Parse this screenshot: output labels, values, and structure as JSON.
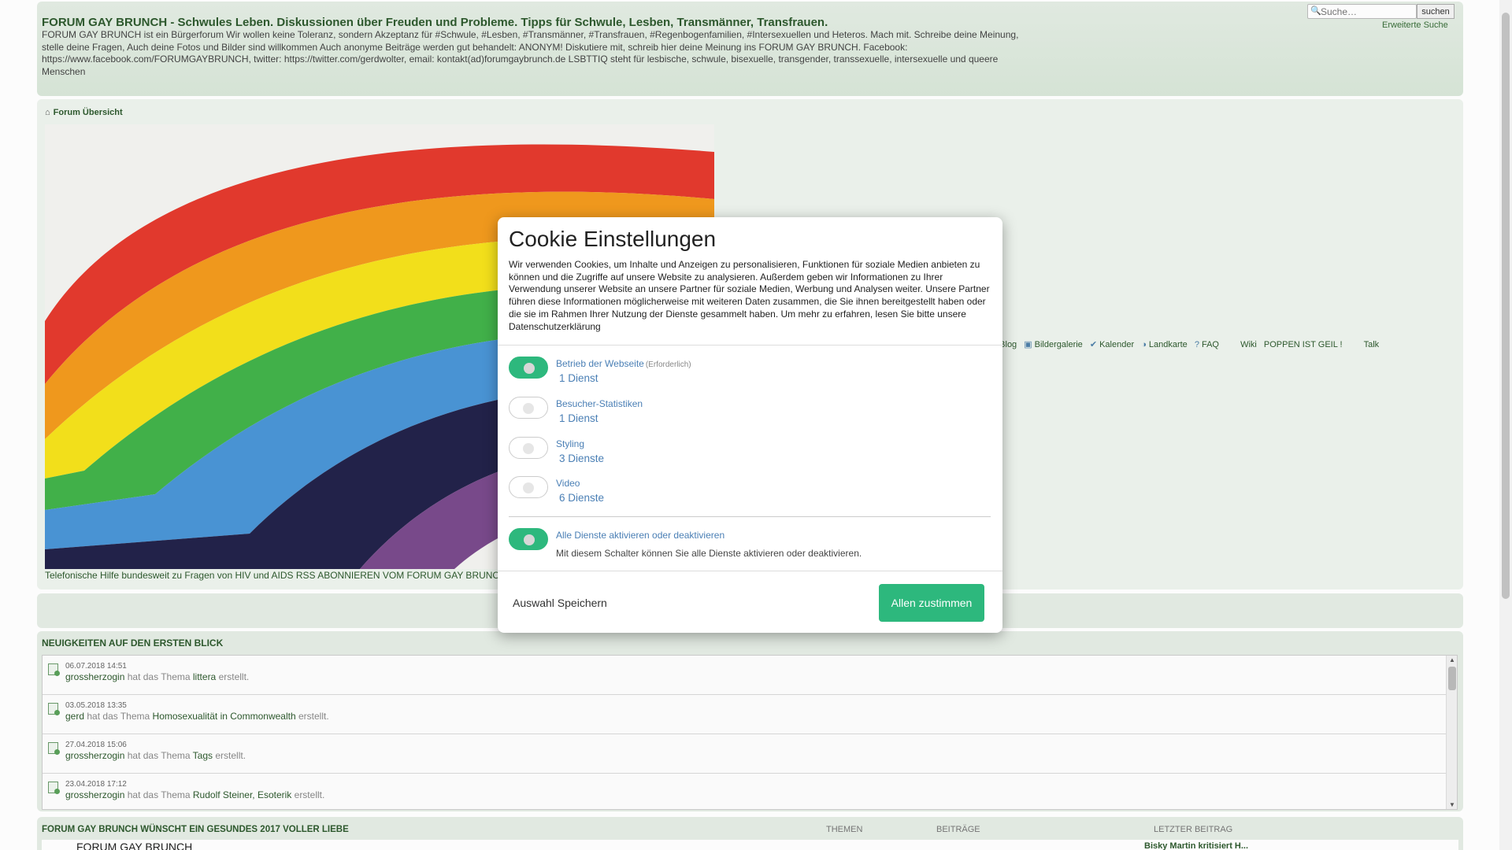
{
  "header": {
    "title": "FORUM GAY BRUNCH - Schwules Leben. Diskussionen über Freuden und Probleme. Tipps für Schwule, Lesben, Transmänner, Transfrauen.",
    "description": "FORUM GAY BRUNCH ist ein Bürgerforum Wir wollen keine Toleranz, sondern Akzeptanz für #Schwule, #Lesben, #Transmänner, #Transfrauen, #Regenbogenfamilien, #Intersexuellen und Heteros. Mach mit. Schreibe deine Meinung, stelle deine Fragen, Auch deine Fotos und Bilder sind willkommen Auch anonyme Beiträge werden gut behandelt: ANONYM! Diskutiere mit, schreib hier deine Meinung ins FORUM GAY BRUNCH. Facebook: https://www.facebook.com/FORUMGAYBRUNCH, twitter: https://twitter.com/gerdwolter, email: kontakt(ad)forumgaybrunch.de LSBTTIQ steht für lesbische, schwule, bisexuelle, transgender, transsexuelle, intersexuelle und queere Menschen",
    "search_placeholder": "Suche…",
    "search_button": "suchen",
    "advanced_search": "Erweiterte Suche"
  },
  "breadcrumb": {
    "label": "Forum Übersicht"
  },
  "navbar": {
    "items": [
      {
        "label": "s-Blog",
        "icon": ""
      },
      {
        "label": "Bildergalerie",
        "icon": "gallery-icon"
      },
      {
        "label": "Kalender",
        "icon": "calendar-icon"
      },
      {
        "label": "Landkarte",
        "icon": "globe-icon"
      },
      {
        "label": "FAQ",
        "icon": "help-icon"
      },
      {
        "label": "Wiki",
        "icon": ""
      },
      {
        "label": "POPPEN IST GEIL !",
        "icon": ""
      },
      {
        "label": "Talk",
        "icon": ""
      }
    ]
  },
  "hiv_line": "Telefonische Hilfe bundesweit zu Fragen von HIV und AIDS   RSS ABONNIEREN VOM FORUM GAY BRUNC",
  "news": {
    "title": "Neuigkeiten auf den ersten Blick",
    "items": [
      {
        "date": "06.07.2018 14:51",
        "user": "grossherzogin",
        "verb": "hat das Thema",
        "topic": "littera",
        "suffix": "erstellt."
      },
      {
        "date": "03.05.2018 13:35",
        "user": "gerd",
        "verb": "hat das Thema",
        "topic": "Homosexualität in Commonwealth",
        "suffix": "erstellt."
      },
      {
        "date": "27.04.2018 15:06",
        "user": "grossherzogin",
        "verb": "hat das Thema",
        "topic": "Tags",
        "suffix": "erstellt."
      },
      {
        "date": "23.04.2018 17:12",
        "user": "grossherzogin",
        "verb": "hat das Thema",
        "topic": "Rudolf Steiner, Esoterik",
        "suffix": "erstellt."
      }
    ]
  },
  "forum_table": {
    "title": "FORUM GAY BRUNCH WÜNSCHT EIN GESUNDES 2017 VOLLER LIEBE",
    "col_topics": "Themen",
    "col_posts": "Beiträge",
    "col_last": "Letzter Beitrag",
    "first_forum": "FORUM GAY BRUNCH",
    "last_post": "Bisky Martin kritisiert H..."
  },
  "cookie": {
    "title": "Cookie Einstellungen",
    "text": "Wir verwenden Cookies, um Inhalte und Anzeigen zu personalisieren, Funktionen für soziale Medien anbieten zu können und die Zugriffe auf unsere Website zu analysieren. Außerdem geben wir Informationen zu Ihrer Verwendung unserer Website an unsere Partner für soziale Medien, Werbung und Analysen weiter. Unsere Partner führen diese Informationen möglicherweise mit weiteren Daten zusammen, die Sie ihnen bereitgestellt haben oder die sie im Rahmen Ihrer Nutzung der Dienste gesammelt haben. Um mehr zu erfahren, lesen Sie bitte unsere Datenschutzerklärung",
    "services": [
      {
        "name": "Betrieb der Webseite",
        "required": "(Erforderlich)",
        "count": "1 Dienst",
        "on": true
      },
      {
        "name": "Besucher-Statistiken",
        "required": "",
        "count": "1 Dienst",
        "on": false
      },
      {
        "name": "Styling",
        "required": "",
        "count": "3 Dienste",
        "on": false
      },
      {
        "name": "Video",
        "required": "",
        "count": "6 Dienste",
        "on": false
      }
    ],
    "all_label": "Alle Dienste aktivieren oder deaktivieren",
    "all_desc": "Mit diesem Schalter können Sie alle Dienste aktivieren oder deaktivieren.",
    "save_label": "Auswahl Speichern",
    "accept_label": "Allen zustimmen",
    "accent": "#2db87d"
  }
}
